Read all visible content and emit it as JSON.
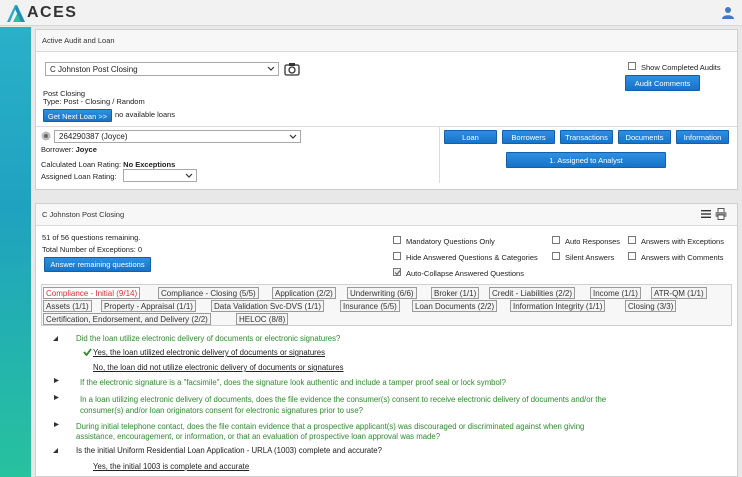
{
  "header": {
    "app_name": "ACES",
    "user_icon": "user-icon"
  },
  "audit_panel": {
    "title": "Active Audit and Loan",
    "audit_select_value": "C Johnston Post Closing",
    "audit_name": "Post Closing",
    "audit_type": "Type: Post - Closing / Random",
    "next_loan_button": "Get Next Loan >>",
    "no_loans_text": "no available loans",
    "show_completed_label": "Show Completed Audits",
    "audit_comments_button": "Audit Comments",
    "loan_select_value": "264290387 (Joyce)",
    "borrower_label": "Borrower:",
    "borrower_value": "Joyce",
    "calc_rating_label": "Calculated Loan Rating:",
    "calc_rating_value": "No Exceptions",
    "assigned_rating_label": "Assigned Loan Rating:",
    "nav_buttons": [
      "Loan",
      "Borrowers",
      "Transactions",
      "Documents",
      "Information"
    ],
    "assigned_button": "1. Assigned to Analyst"
  },
  "questions_panel": {
    "title": "C Johnston Post Closing",
    "remaining_text": "51 of 56 questions remaining.",
    "exceptions_text": "Total Number of Exceptions: 0",
    "answer_remaining_button": "Answer remaining questions",
    "filters": {
      "mandatory": "Mandatory Questions Only",
      "auto_responses": "Auto Responses",
      "with_exceptions": "Answers with Exceptions",
      "hide_answered": "Hide Answered Questions & Categories",
      "silent_answers": "Silent Answers",
      "with_comments": "Answers with Comments",
      "auto_collapse": "Auto-Collapse Answered Questions"
    },
    "tabs_row1": [
      "Compliance - Initial (9/14)",
      "Compliance - Closing (5/5)",
      "Application (2/2)",
      "Underwriting (6/6)",
      "Broker (1/1)",
      "Credit - Liabilities (2/2)",
      "Income (1/1)",
      "ATR-QM (1/1)"
    ],
    "tabs_row2": [
      "Assets (1/1)",
      "Property - Appraisal (1/1)",
      "Data Validation Svc-DVS (1/1)",
      "Insurance (5/5)",
      "Loan Documents (2/2)",
      "Information Integrity (1/1)",
      "Closing (3/3)"
    ],
    "tabs_row3": [
      "Certification, Endorsement, and Delivery (2/2)",
      "HELOC (8/8)"
    ],
    "q1": "Did the loan utilize electronic delivery of documents or electronic signatures?",
    "q1_a1": "Yes, the loan utilized electronic delivery of documents or signatures",
    "q1_a2": "No, the loan did not utilize electronic delivery of documents or signatures",
    "q2": "If the electronic signature is a \"facsimile\", does the signature look authentic and include a tamper proof seal or lock symbol?",
    "q3_l1": "In a loan utilizing electronic delivery of documents, does the file evidence the consumer(s) consent to receive electronic delivery of documents and/or the",
    "q3_l2": "consumer(s) and/or loan originators consent for electronic signatures prior to use?",
    "q4_l1": "During initial telephone contact, does the file contain evidence that a prospective applicant(s) was discouraged or discriminated against when giving",
    "q4_l2": "assistance, encouragement, or information, or that an evaluation of prospective loan approval was made?",
    "q5": "Is the initial Uniform Residential Loan Application - URLA (1003) complete and accurate?",
    "q5_a1": "Yes, the initial 1003 is complete and accurate"
  }
}
